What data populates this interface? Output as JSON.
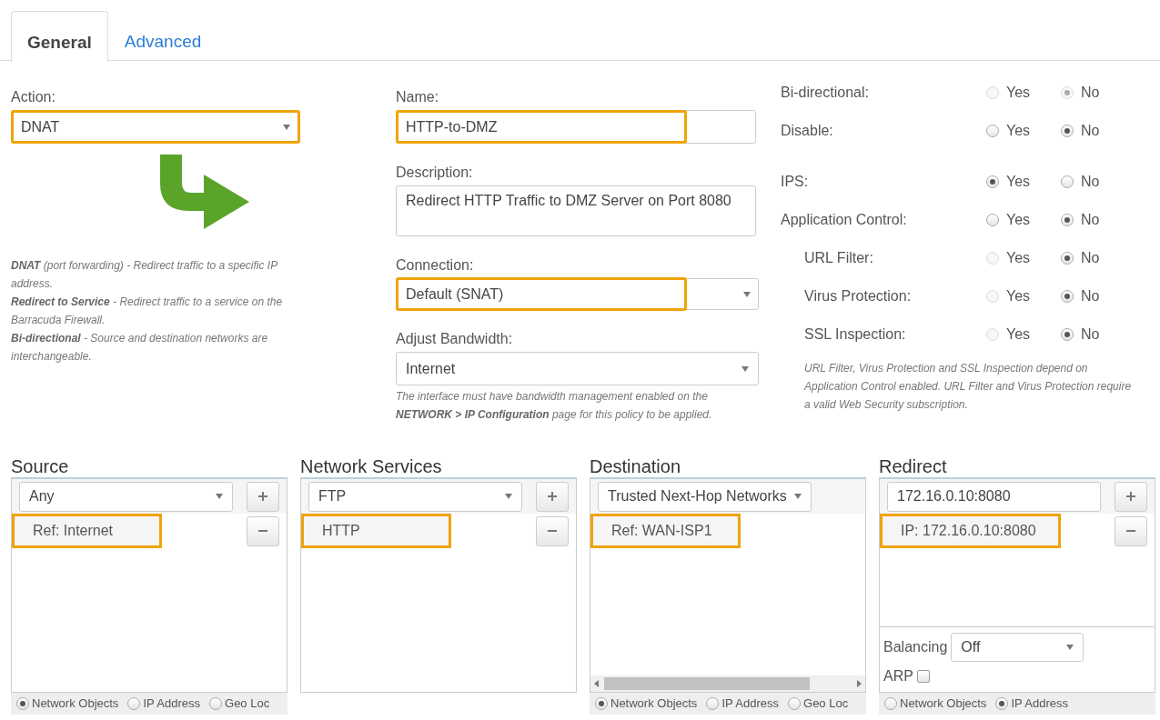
{
  "tabs": [
    {
      "label": "General",
      "selected": true
    },
    {
      "label": "Advanced",
      "selected": false
    }
  ],
  "action": {
    "label": "Action:",
    "value": "DNAT",
    "highlighted": true
  },
  "action_help": [
    "**DNAT** (port forwarding) - Redirect traffic to a specific IP address.",
    "**Redirect to Service** - Redirect traffic to a service on the Barracuda Firewall.",
    "**Bi-directional** - Source and destination networks are interchangeable."
  ],
  "name": {
    "label": "Name:",
    "value": "HTTP-to-DMZ",
    "highlighted": true
  },
  "description": {
    "label": "Description:",
    "value": "Redirect HTTP Traffic to DMZ Server on Port 8080"
  },
  "connection": {
    "label": "Connection:",
    "value": "Default (SNAT)",
    "highlighted": true
  },
  "bandwidth": {
    "label": "Adjust Bandwidth:",
    "value": "Internet",
    "note": "The interface must have bandwidth management enabled on the **NETWORK > IP Configuration** page for this policy to be applied."
  },
  "toggle_groups": [
    [
      {
        "label": "Bi-directional:",
        "indented": false,
        "options": [
          {
            "label": "Yes",
            "selected": false,
            "disabled": true
          },
          {
            "label": "No",
            "selected": true,
            "disabled": true
          }
        ]
      },
      {
        "label": "Disable:",
        "indented": false,
        "options": [
          {
            "label": "Yes",
            "selected": false,
            "disabled": false
          },
          {
            "label": "No",
            "selected": true,
            "disabled": false
          }
        ]
      }
    ],
    [
      {
        "label": "IPS:",
        "indented": false,
        "options": [
          {
            "label": "Yes",
            "selected": true,
            "disabled": false
          },
          {
            "label": "No",
            "selected": false,
            "disabled": false
          }
        ]
      },
      {
        "label": "Application Control:",
        "indented": false,
        "options": [
          {
            "label": "Yes",
            "selected": false,
            "disabled": false
          },
          {
            "label": "No",
            "selected": true,
            "disabled": false
          }
        ]
      },
      {
        "label": "URL Filter:",
        "indented": true,
        "options": [
          {
            "label": "Yes",
            "selected": false,
            "disabled": true
          },
          {
            "label": "No",
            "selected": true,
            "disabled": false
          }
        ]
      },
      {
        "label": "Virus Protection:",
        "indented": true,
        "options": [
          {
            "label": "Yes",
            "selected": false,
            "disabled": true
          },
          {
            "label": "No",
            "selected": true,
            "disabled": false
          }
        ]
      },
      {
        "label": "SSL Inspection:",
        "indented": true,
        "options": [
          {
            "label": "Yes",
            "selected": false,
            "disabled": true
          },
          {
            "label": "No",
            "selected": true,
            "disabled": false
          }
        ]
      }
    ]
  ],
  "toggle_note": "URL Filter, Virus Protection and SSL Inspection depend on Application Control enabled. URL Filter and Virus Protection require a valid Web Security subscription.",
  "panels": [
    {
      "title": "Source",
      "select": "Any",
      "buttons": true,
      "scrollbar": false,
      "items": [
        {
          "text": "Ref: Internet",
          "highlighted": true
        }
      ],
      "footer": [
        {
          "label": "Network Objects",
          "selected": true
        },
        {
          "label": "IP Address",
          "selected": false
        },
        {
          "label": "Geo Loc",
          "selected": false
        }
      ]
    },
    {
      "title": "Network Services",
      "select": "FTP",
      "buttons": true,
      "scrollbar": false,
      "items": [
        {
          "text": "HTTP",
          "highlighted": true
        }
      ]
    },
    {
      "title": "Destination",
      "select": "Trusted Next-Hop Networks",
      "buttons": false,
      "scrollbar": true,
      "items": [
        {
          "text": "Ref: WAN-ISP1",
          "highlighted": true
        }
      ],
      "footer": [
        {
          "label": "Network Objects",
          "selected": true
        },
        {
          "label": "IP Address",
          "selected": false
        },
        {
          "label": "Geo Loc",
          "selected": false
        }
      ]
    },
    {
      "title": "Redirect",
      "input": "172.16.0.10:8080",
      "buttons": true,
      "scrollbar": false,
      "items": [
        {
          "text": "IP: 172.16.0.10:8080",
          "highlighted": true
        }
      ],
      "options": {
        "balancing_label": "Balancing",
        "balancing": "Off",
        "arp_label": "ARP",
        "arp_checked": false
      },
      "footer": [
        {
          "label": "Network Objects",
          "selected": false
        },
        {
          "label": "IP Address",
          "selected": true
        }
      ]
    }
  ]
}
